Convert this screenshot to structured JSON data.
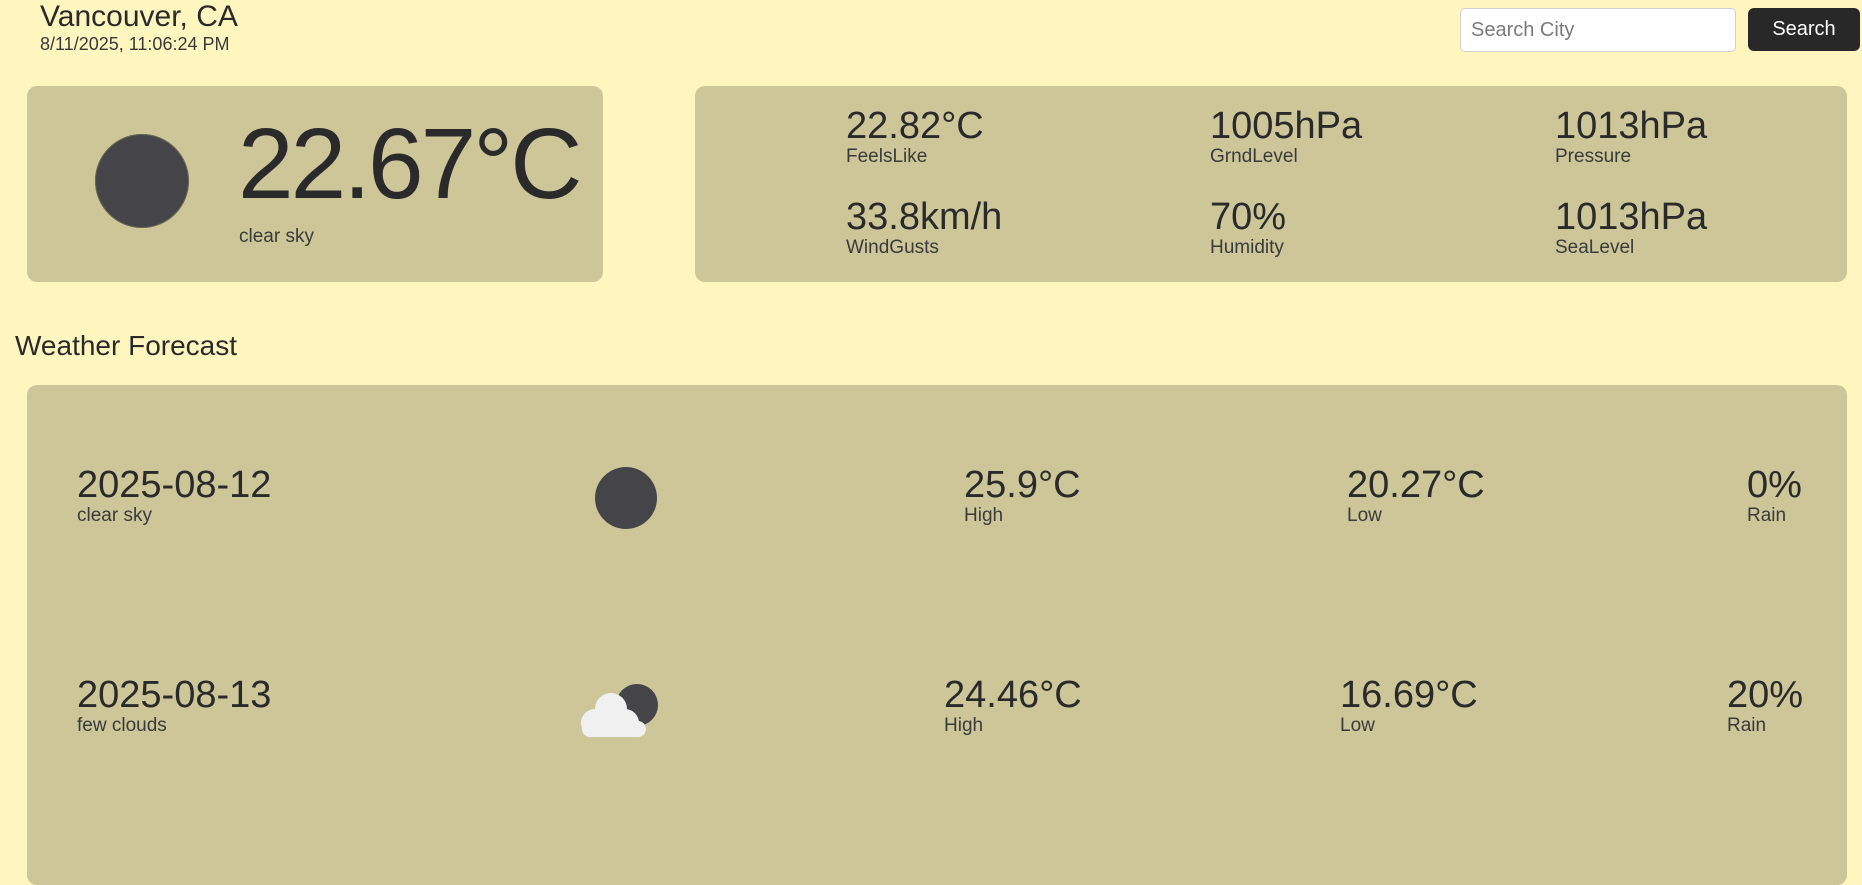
{
  "header": {
    "city": "Vancouver, CA",
    "datetime": "8/11/2025, 11:06:24 PM"
  },
  "search": {
    "placeholder": "Search City",
    "button_label": "Search"
  },
  "current": {
    "temp": "22.67°C",
    "description": "clear sky",
    "icon": "clear-sky-icon"
  },
  "details": {
    "feels_like": {
      "value": "22.82°C",
      "label": "FeelsLike"
    },
    "grnd_level": {
      "value": "1005hPa",
      "label": "GrndLevel"
    },
    "pressure": {
      "value": "1013hPa",
      "label": "Pressure"
    },
    "wind_gusts": {
      "value": "33.8km/h",
      "label": "WindGusts"
    },
    "humidity": {
      "value": "70%",
      "label": "Humidity"
    },
    "sea_level": {
      "value": "1013hPa",
      "label": "SeaLevel"
    }
  },
  "forecast": {
    "title": "Weather Forecast",
    "days": [
      {
        "date": "2025-08-12",
        "description": "clear sky",
        "icon": "clear-sky-icon",
        "high": "25.9°C",
        "high_label": "High",
        "low": "20.27°C",
        "low_label": "Low",
        "rain": "0%",
        "rain_label": "Rain"
      },
      {
        "date": "2025-08-13",
        "description": "few clouds",
        "icon": "few-clouds-icon",
        "high": "24.46°C",
        "high_label": "High",
        "low": "16.69°C",
        "low_label": "Low",
        "rain": "20%",
        "rain_label": "Rain"
      }
    ]
  },
  "colors": {
    "page_background": "#fff6bf",
    "card_background": "#ccc699",
    "button_background": "#282828",
    "icon_dark": "#454449",
    "cloud": "#f0f0f0"
  }
}
